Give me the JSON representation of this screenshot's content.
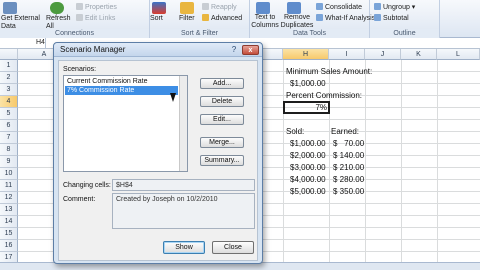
{
  "ribbon": {
    "groups": [
      {
        "label": "Connections",
        "buttons": [
          "Get External Data",
          "Refresh All",
          "Properties",
          "Edit Links"
        ]
      },
      {
        "label": "Sort & Filter",
        "buttons": [
          "Sort",
          "Filter",
          "Reapply",
          "Advanced"
        ]
      },
      {
        "label": "Data Tools",
        "buttons": [
          "Text to Columns",
          "Remove Duplicates",
          "Consolidate",
          "What-If Analysis"
        ]
      },
      {
        "label": "Outline",
        "buttons": [
          "Ungroup",
          "Subtotal"
        ]
      }
    ]
  },
  "formula_bar": {
    "name_box": "H4"
  },
  "columns": [
    "A",
    "H",
    "I",
    "J",
    "K",
    "L"
  ],
  "rows": [
    "1",
    "2",
    "3",
    "4",
    "5",
    "6",
    "7",
    "8",
    "9",
    "10",
    "11",
    "12",
    "13",
    "14",
    "15",
    "16",
    "17"
  ],
  "sheet": {
    "min_sales_label": "Minimum Sales Amount:",
    "min_sales_value": "$1,000.00",
    "pct_commission_label": "Percent Commission:",
    "pct_commission_value": "7%",
    "sold_header": "Sold:",
    "earned_header": "Earned:",
    "table": [
      {
        "sold": "$1,000.00",
        "earned": "$   70.00"
      },
      {
        "sold": "$2,000.00",
        "earned": "$ 140.00"
      },
      {
        "sold": "$3,000.00",
        "earned": "$ 210.00"
      },
      {
        "sold": "$4,000.00",
        "earned": "$ 280.00"
      },
      {
        "sold": "$5,000.00",
        "earned": "$ 350.00"
      }
    ]
  },
  "dialog": {
    "title": "Scenario Manager",
    "help": "?",
    "close": "x",
    "scenarios_label": "Scenarios:",
    "scenarios": [
      "Current Commission Rate",
      "7% Commission Rate"
    ],
    "selected_index": 1,
    "side_buttons": {
      "add": "Add...",
      "delete": "Delete",
      "edit": "Edit...",
      "merge": "Merge...",
      "summary": "Summary..."
    },
    "changing_cells_label": "Changing cells:",
    "changing_cells_value": "$H$4",
    "comment_label": "Comment:",
    "comment_value": "Created by Joseph on 10/2/2010",
    "show_button": "Show",
    "close_button": "Close"
  }
}
